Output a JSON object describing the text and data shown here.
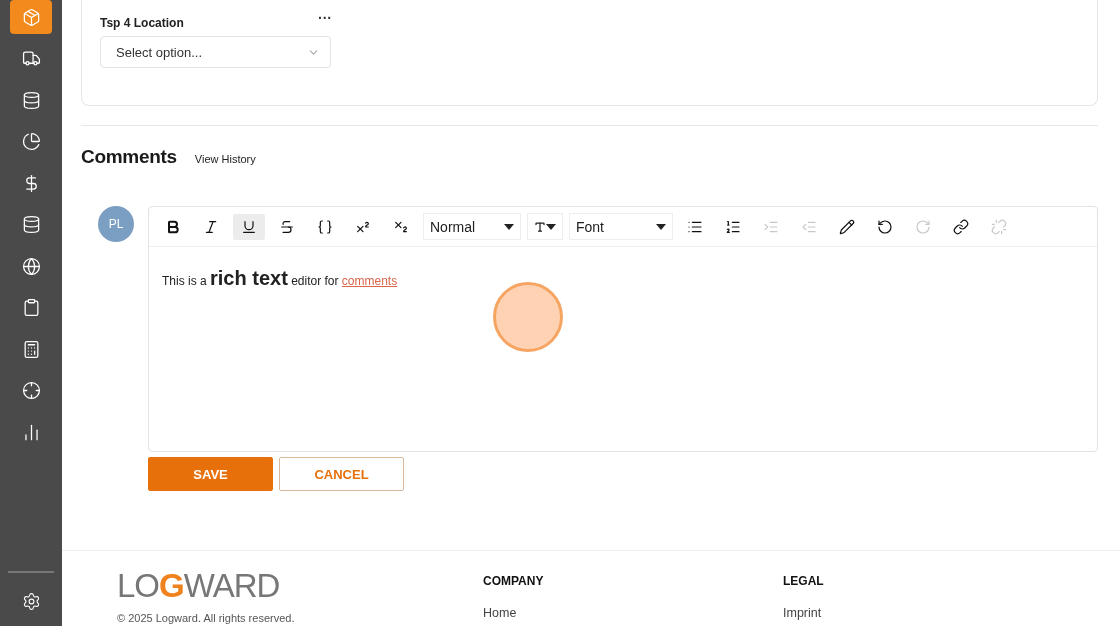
{
  "sidebar": {
    "items": [
      {
        "kind": "box",
        "selected": true
      },
      {
        "kind": "truck",
        "selected": false
      },
      {
        "kind": "database",
        "selected": false
      },
      {
        "kind": "pie",
        "selected": false
      },
      {
        "kind": "dollar",
        "selected": false
      },
      {
        "kind": "database",
        "selected": false
      },
      {
        "kind": "globe",
        "selected": false
      },
      {
        "kind": "clipboard",
        "selected": false
      },
      {
        "kind": "calculator",
        "selected": false
      },
      {
        "kind": "target",
        "selected": false
      },
      {
        "kind": "chart",
        "selected": false
      }
    ],
    "bottom": {
      "kind": "settings"
    }
  },
  "field": {
    "label": "Tsp 4 Location",
    "menu": "···",
    "placeholder": "Select option..."
  },
  "comments": {
    "title": "Comments",
    "history_link": "View History",
    "avatar": "PL",
    "toolbar": [
      {
        "kind": "bold",
        "active": false,
        "disabled": false
      },
      {
        "kind": "italic",
        "active": false,
        "disabled": false
      },
      {
        "kind": "underline",
        "active": true,
        "disabled": false
      },
      {
        "kind": "strike",
        "active": false,
        "disabled": false
      },
      {
        "kind": "code",
        "active": false,
        "disabled": false
      },
      {
        "kind": "superscript",
        "active": false,
        "disabled": false
      },
      {
        "kind": "subscript",
        "active": false,
        "disabled": false
      },
      {
        "kind": "select",
        "value": "Normal"
      },
      {
        "kind": "size-select"
      },
      {
        "kind": "select",
        "value": "Font"
      },
      {
        "kind": "bullets",
        "active": false,
        "disabled": false
      },
      {
        "kind": "numbers",
        "active": false,
        "disabled": false
      },
      {
        "kind": "indent",
        "active": false,
        "disabled": true
      },
      {
        "kind": "outdent",
        "active": false,
        "disabled": true
      },
      {
        "kind": "color",
        "active": false,
        "disabled": false
      },
      {
        "kind": "undo",
        "active": false,
        "disabled": false
      },
      {
        "kind": "redo",
        "active": false,
        "disabled": true
      },
      {
        "kind": "link",
        "active": false,
        "disabled": false
      },
      {
        "kind": "unlink",
        "active": false,
        "disabled": true
      }
    ],
    "content": [
      {
        "kind": "plain",
        "text": "This is a "
      },
      {
        "kind": "large-bold",
        "text": "rich text"
      },
      {
        "kind": "plain",
        "text": " editor for "
      },
      {
        "kind": "link",
        "text": "comments"
      }
    ],
    "buttons": [
      {
        "kind": "primary",
        "label": "SAVE"
      },
      {
        "kind": "secondary",
        "label": "CANCEL"
      }
    ]
  },
  "footer": {
    "logo": [
      {
        "kind": "grey",
        "text": "LO"
      },
      {
        "kind": "accent",
        "text": "G"
      },
      {
        "kind": "grey",
        "text": "WARD"
      }
    ],
    "copyright": "© 2025 Logward. All rights reserved.",
    "columns": [
      {
        "title": "COMPANY",
        "links": [
          "Home"
        ]
      },
      {
        "title": "LEGAL",
        "links": [
          "Imprint"
        ]
      }
    ]
  }
}
